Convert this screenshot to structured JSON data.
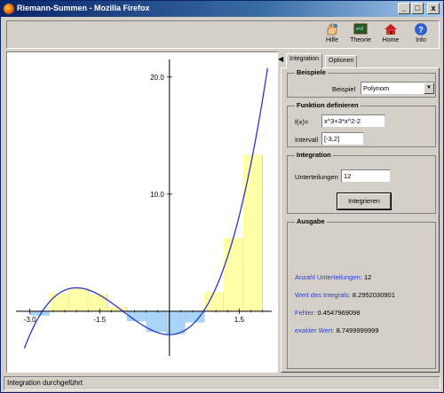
{
  "window": {
    "title": "Riemann-Summen - Mozilla Firefox",
    "min": "_",
    "max": "□",
    "close": "x"
  },
  "toolbar": {
    "items": [
      {
        "label": "Hilfe",
        "icon": "hand-icon"
      },
      {
        "label": "Theorie",
        "icon": "theory-board-icon"
      },
      {
        "label": "Home",
        "icon": "home-icon"
      },
      {
        "label": "Info",
        "icon": "info-icon"
      }
    ]
  },
  "tabs": {
    "active": "Integration",
    "other": "Optionen"
  },
  "beispiele": {
    "title": "Beispiele",
    "label": "Beispiel",
    "value": "Polynom"
  },
  "funktion": {
    "title": "Funktion definieren",
    "f_label": "f(x)=",
    "f_value": "x^3+3*x^2-2",
    "i_label": "Intervall",
    "i_value": "[-3,2]"
  },
  "integration": {
    "title": "Integration",
    "u_label": "Unterteilungen",
    "u_value": "12",
    "button": "Integrieren"
  },
  "ausgabe": {
    "title": "Ausgabe",
    "rows": [
      {
        "key": "Anzahl Unterteilungen:",
        "value": "12"
      },
      {
        "key": "Wert des Integrals:",
        "value": "8.2952030901"
      },
      {
        "key": "Fehler:",
        "value": "0.4547969098"
      },
      {
        "key": "exakter Wert:",
        "value": "8.7499999999"
      }
    ]
  },
  "status": "Integration durchgeführt",
  "colors": {
    "curve": "#2a35c8",
    "positive_fill": "#ffffa8",
    "negative_fill": "#a8d4f8"
  },
  "chart_data": {
    "type": "area",
    "function": "x^3+3*x^2-2",
    "interval": [
      -3,
      2
    ],
    "subdivisions": 12,
    "xlim": [
      -3.3,
      2.2
    ],
    "ylim": [
      -3.8,
      21.5
    ],
    "x_ticks": [
      -3.0,
      -1.5,
      1.5
    ],
    "x_tick_labels": [
      "-3.0",
      "-1.5",
      "1.5"
    ],
    "y_ticks": [
      10.0,
      20.0
    ],
    "y_tick_labels": [
      "10.0",
      "20.0"
    ],
    "grid": false,
    "legend": "none"
  }
}
